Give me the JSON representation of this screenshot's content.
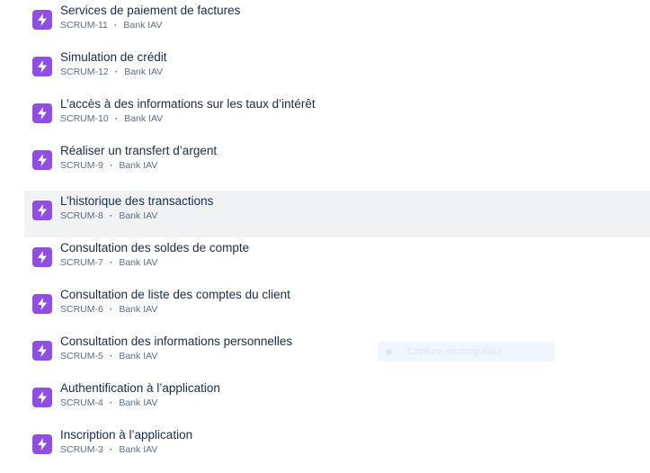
{
  "items": [
    {
      "title": "Services de paiement de factures",
      "key": "SCRUM-11",
      "project": "Bank IAV"
    },
    {
      "title": "Simulation de crédit",
      "key": "SCRUM-12",
      "project": "Bank IAV"
    },
    {
      "title": "L’accès à des informations sur les taux d’intérêt",
      "key": "SCRUM-10",
      "project": "Bank IAV"
    },
    {
      "title": "Réaliser un transfert d’argent",
      "key": "SCRUM-9",
      "project": "Bank IAV"
    },
    {
      "title": "L’historique des transactions",
      "key": "SCRUM-8",
      "project": "Bank IAV"
    },
    {
      "title": "Consultation des soldes de compte",
      "key": "SCRUM-7",
      "project": "Bank IAV"
    },
    {
      "title": "Consultation de liste des comptes du client",
      "key": "SCRUM-6",
      "project": "Bank IAV"
    },
    {
      "title": "Consultation des informations personnelles",
      "key": "SCRUM-5",
      "project": "Bank IAV"
    },
    {
      "title": "Authentification à l’application",
      "key": "SCRUM-4",
      "project": "Bank IAV"
    },
    {
      "title": "Inscription à l’application",
      "key": "SCRUM-3",
      "project": "Bank IAV"
    }
  ],
  "separator": "·",
  "icon": "lightning-bolt-icon",
  "accent_color": "#904ee2",
  "overlay": {
    "label": "Capture rectangulaire",
    "icon": "capture-icon"
  }
}
